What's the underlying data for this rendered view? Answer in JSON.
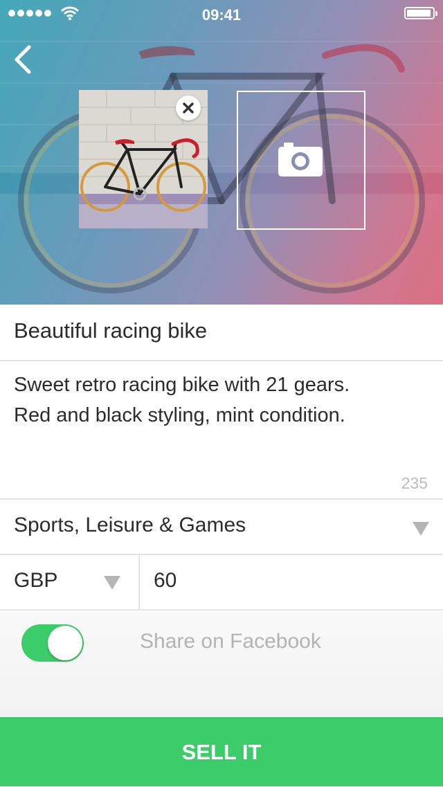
{
  "status_bar": {
    "time": "09:41",
    "battery_level": 0.95
  },
  "listing": {
    "title": "Beautiful racing bike",
    "description": "Sweet retro racing bike with 21 gears.\nRed and black styling, mint condition.",
    "char_count": "235",
    "category": "Sports, Leisure & Games",
    "currency": "GBP",
    "price": "60"
  },
  "share": {
    "label": "Share on Facebook",
    "enabled": true
  },
  "actions": {
    "sell_label": "SELL IT"
  },
  "icons": {
    "back": "back-chevron-icon",
    "remove": "close-icon",
    "camera": "camera-icon",
    "dropdown": "triangle-down-icon"
  },
  "colors": {
    "accent": "#3dcc6a",
    "placeholder": "#b3b3b3",
    "text": "#2b2b2b"
  }
}
